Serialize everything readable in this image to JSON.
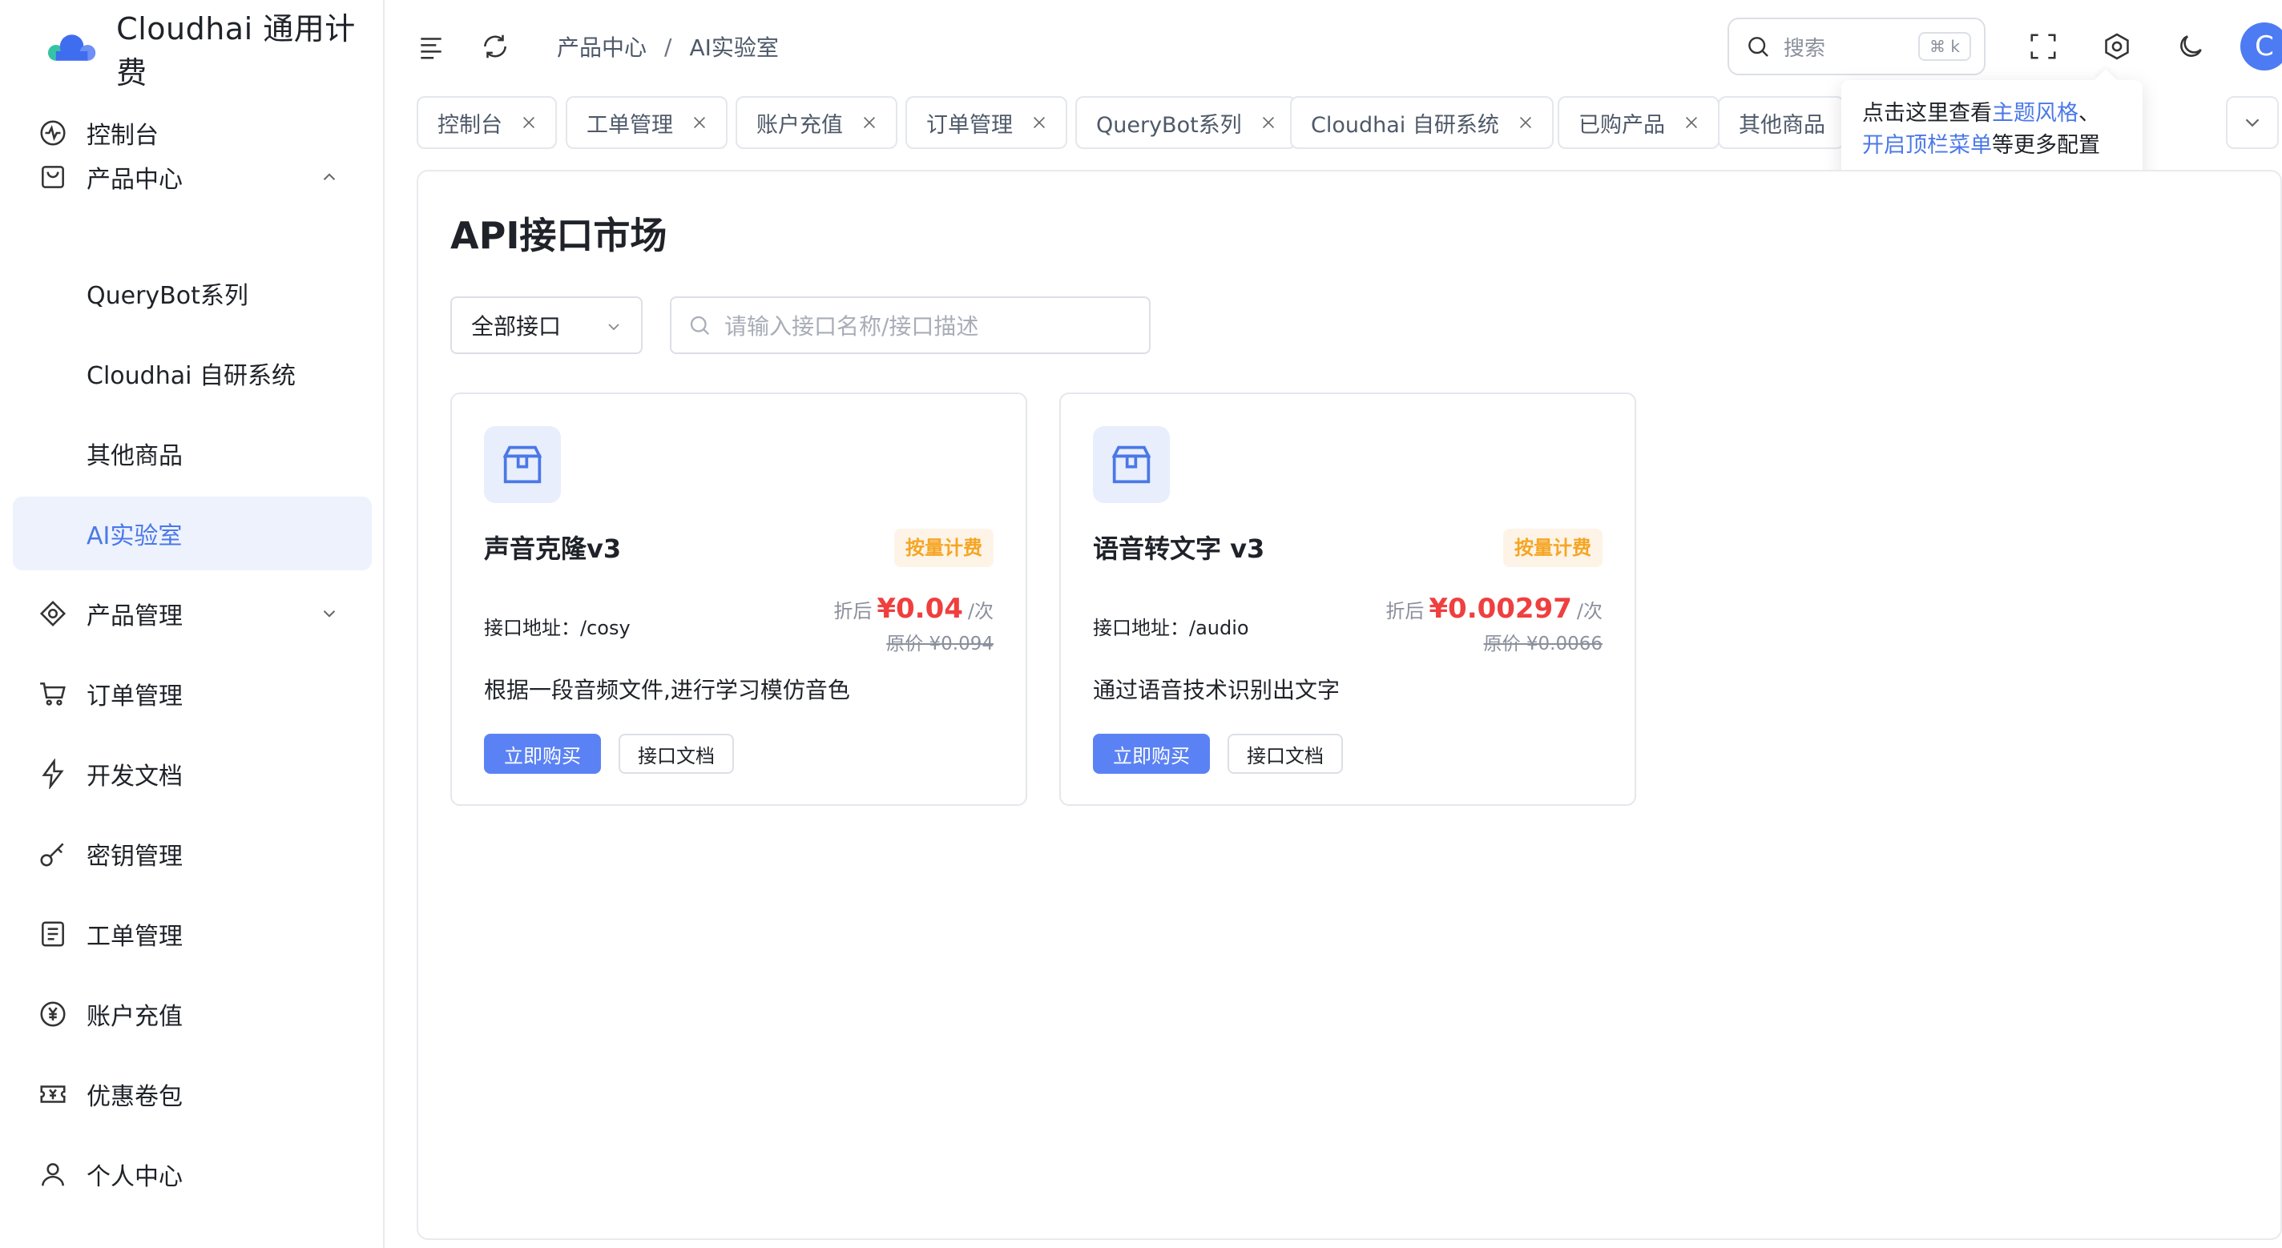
{
  "brand": {
    "name": "Cloudhai 通用计费"
  },
  "sidebar": {
    "items": [
      {
        "label": "控制台",
        "icon": "dashboard-icon"
      },
      {
        "label": "产品中心",
        "icon": "bag-icon",
        "expanded": true
      },
      {
        "label": "QueryBot系列",
        "sub": true
      },
      {
        "label": "Cloudhai 自研系统",
        "sub": true
      },
      {
        "label": "其他商品",
        "sub": true
      },
      {
        "label": "AI实验室",
        "sub": true,
        "active": true
      },
      {
        "label": "产品管理",
        "icon": "diamond-icon",
        "expanded": false
      },
      {
        "label": "订单管理",
        "icon": "cart-icon"
      },
      {
        "label": "开发文档",
        "icon": "bolt-icon"
      },
      {
        "label": "密钥管理",
        "icon": "key-icon"
      },
      {
        "label": "工单管理",
        "icon": "document-icon"
      },
      {
        "label": "账户充值",
        "icon": "yuan-coin-icon"
      },
      {
        "label": "优惠卷包",
        "icon": "coupon-icon"
      },
      {
        "label": "个人中心",
        "icon": "user-icon"
      }
    ]
  },
  "header": {
    "breadcrumb": [
      "产品中心",
      "AI实验室"
    ],
    "breadcrumb_sep": "/",
    "search": {
      "placeholder": "搜索",
      "shortcut": "⌘ k"
    },
    "avatar_initial": "C"
  },
  "tabs": [
    "控制台",
    "工单管理",
    "账户充值",
    "订单管理",
    "QueryBot系列",
    "Cloudhai 自研系统",
    "已购产品",
    "其他商品"
  ],
  "tooltip": {
    "text1": "点击这里查看",
    "link1": "主题风格",
    "text2": "、",
    "link2": "开启顶栏菜单",
    "text3": "等更多配置"
  },
  "main": {
    "title": "API接口市场",
    "filter_select": "全部接口",
    "search_placeholder": "请输入接口名称/接口描述",
    "cards": [
      {
        "name": "声音克隆v3",
        "badge": "按量计费",
        "addr_label": "接口地址：",
        "addr": "/cosy",
        "price_label": "折后",
        "price": "¥0.04",
        "unit": "/次",
        "orig_price": "原价 ¥0.094",
        "desc": "根据一段音频文件,进行学习模仿音色",
        "buy": "立即购买",
        "doc": "接口文档"
      },
      {
        "name": "语音转文字 v3",
        "badge": "按量计费",
        "addr_label": "接口地址：",
        "addr": "/audio",
        "price_label": "折后",
        "price": "¥0.00297",
        "unit": "/次",
        "orig_price": "原价 ¥0.0066",
        "desc": "通过语音技术识别出文字",
        "buy": "立即购买",
        "doc": "接口文档"
      }
    ]
  },
  "colors": {
    "accent": "#4b78e8",
    "price": "#ef3f3f",
    "badge": "#f5a524",
    "button": "#5b82f4"
  }
}
